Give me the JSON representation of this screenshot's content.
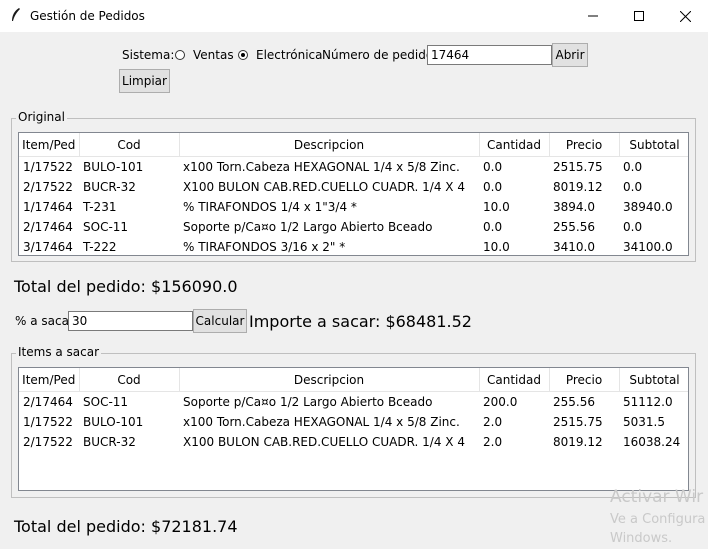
{
  "window": {
    "title": "Gestión de Pedidos"
  },
  "toolbar": {
    "sistema_label": "Sistema:",
    "option_ventas": "Ventas",
    "option_electronica": "Electrónica",
    "selected_option": "Electrónica",
    "pedido_label": "Número de pedido:",
    "pedido_value": "17464",
    "abrir_label": "Abrir",
    "limpiar_label": "Limpiar"
  },
  "original": {
    "legend": "Original",
    "columns": [
      "Item/Ped",
      "Cod",
      "Descripcion",
      "Cantidad",
      "Precio",
      "Subtotal"
    ],
    "rows": [
      [
        "1/17522",
        "BULO-101",
        "x100 Torn.Cabeza HEXAGONAL 1/4 x 5/8    Zinc.",
        "0.0",
        "2515.75",
        "0.0"
      ],
      [
        "2/17522",
        "BUCR-32",
        "X100 BULON CAB.RED.CUELLO CUADR. 1/4 X 4",
        "0.0",
        "8019.12",
        "0.0"
      ],
      [
        "1/17464",
        "T-231",
        "% TIRAFONDOS 1/4 x 1\"3/4 *",
        "10.0",
        "3894.0",
        "38940.0"
      ],
      [
        "2/17464",
        "SOC-11",
        "Soporte p/Ca¤o 1/2 Largo Abierto Bceado",
        "0.0",
        "255.56",
        "0.0"
      ],
      [
        "3/17464",
        "T-222",
        "% TIRAFONDOS 3/16 x 2\" *",
        "10.0",
        "3410.0",
        "34100.0"
      ]
    ],
    "total_text": "Total del pedido: $156090.0"
  },
  "sacar": {
    "pct_label": "% a sacar:",
    "pct_value": "30",
    "calcular_label": "Calcular",
    "importe_text": "Importe a sacar: $68481.52"
  },
  "items": {
    "legend": "Items a sacar",
    "columns": [
      "Item/Ped",
      "Cod",
      "Descripcion",
      "Cantidad",
      "Precio",
      "Subtotal"
    ],
    "rows": [
      [
        "2/17464",
        "SOC-11",
        "Soporte p/Ca¤o 1/2 Largo Abierto Bceado",
        "200.0",
        "255.56",
        "51112.0"
      ],
      [
        "1/17522",
        "BULO-101",
        "x100 Torn.Cabeza HEXAGONAL 1/4 x 5/8    Zinc.",
        "2.0",
        "2515.75",
        "5031.5"
      ],
      [
        "2/17522",
        "BUCR-32",
        "X100 BULON CAB.RED.CUELLO CUADR. 1/4 X 4",
        "2.0",
        "8019.12",
        "16038.24"
      ]
    ],
    "total_text": "Total del pedido: $72181.74"
  },
  "watermark": {
    "line1": "Activar Wir",
    "line2": "Ve a Configura",
    "line3": "Windows."
  }
}
